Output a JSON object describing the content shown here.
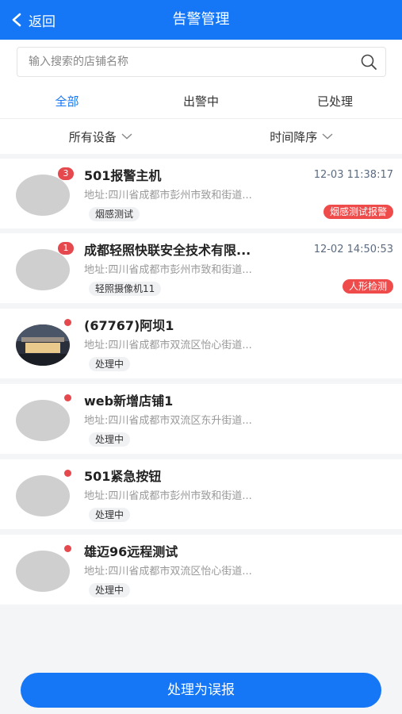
{
  "header": {
    "back_label": "返回",
    "title": "告警管理"
  },
  "search": {
    "placeholder": "输入搜索的店铺名称"
  },
  "tabs": [
    {
      "label": "全部"
    },
    {
      "label": "出警中"
    },
    {
      "label": "已处理"
    }
  ],
  "filters": {
    "device": "所有设备",
    "sort": "时间降序"
  },
  "items": [
    {
      "name": "501报警主机",
      "count": "3",
      "time": "12-03 11:38:17",
      "address": "地址:四川省成都市彭州市致和街道...",
      "tag": "烟感测试",
      "alarm": "烟感测试报警"
    },
    {
      "name": "成都轻照快联安全技术有限...",
      "count": "1",
      "time": "12-02 14:50:53",
      "address": "地址:四川省成都市彭州市致和街道...",
      "tag": "轻照摄像机11",
      "alarm": "人形检测"
    },
    {
      "name": "(67767)阿坝1",
      "address": "地址:四川省成都市双流区怡心街道...",
      "tag": "处理中"
    },
    {
      "name": "web新增店铺1",
      "address": "地址:四川省成都市双流区东升街道...",
      "tag": "处理中"
    },
    {
      "name": "501紧急按钮",
      "address": "地址:四川省成都市彭州市致和街道...",
      "tag": "处理中"
    },
    {
      "name": "雄迈96远程测试",
      "address": "地址:四川省成都市双流区怡心街道...",
      "tag": "处理中"
    }
  ],
  "footer": {
    "button_label": "处理为误报"
  },
  "colors": {
    "primary": "#1677f6",
    "alert": "#e5484d"
  }
}
